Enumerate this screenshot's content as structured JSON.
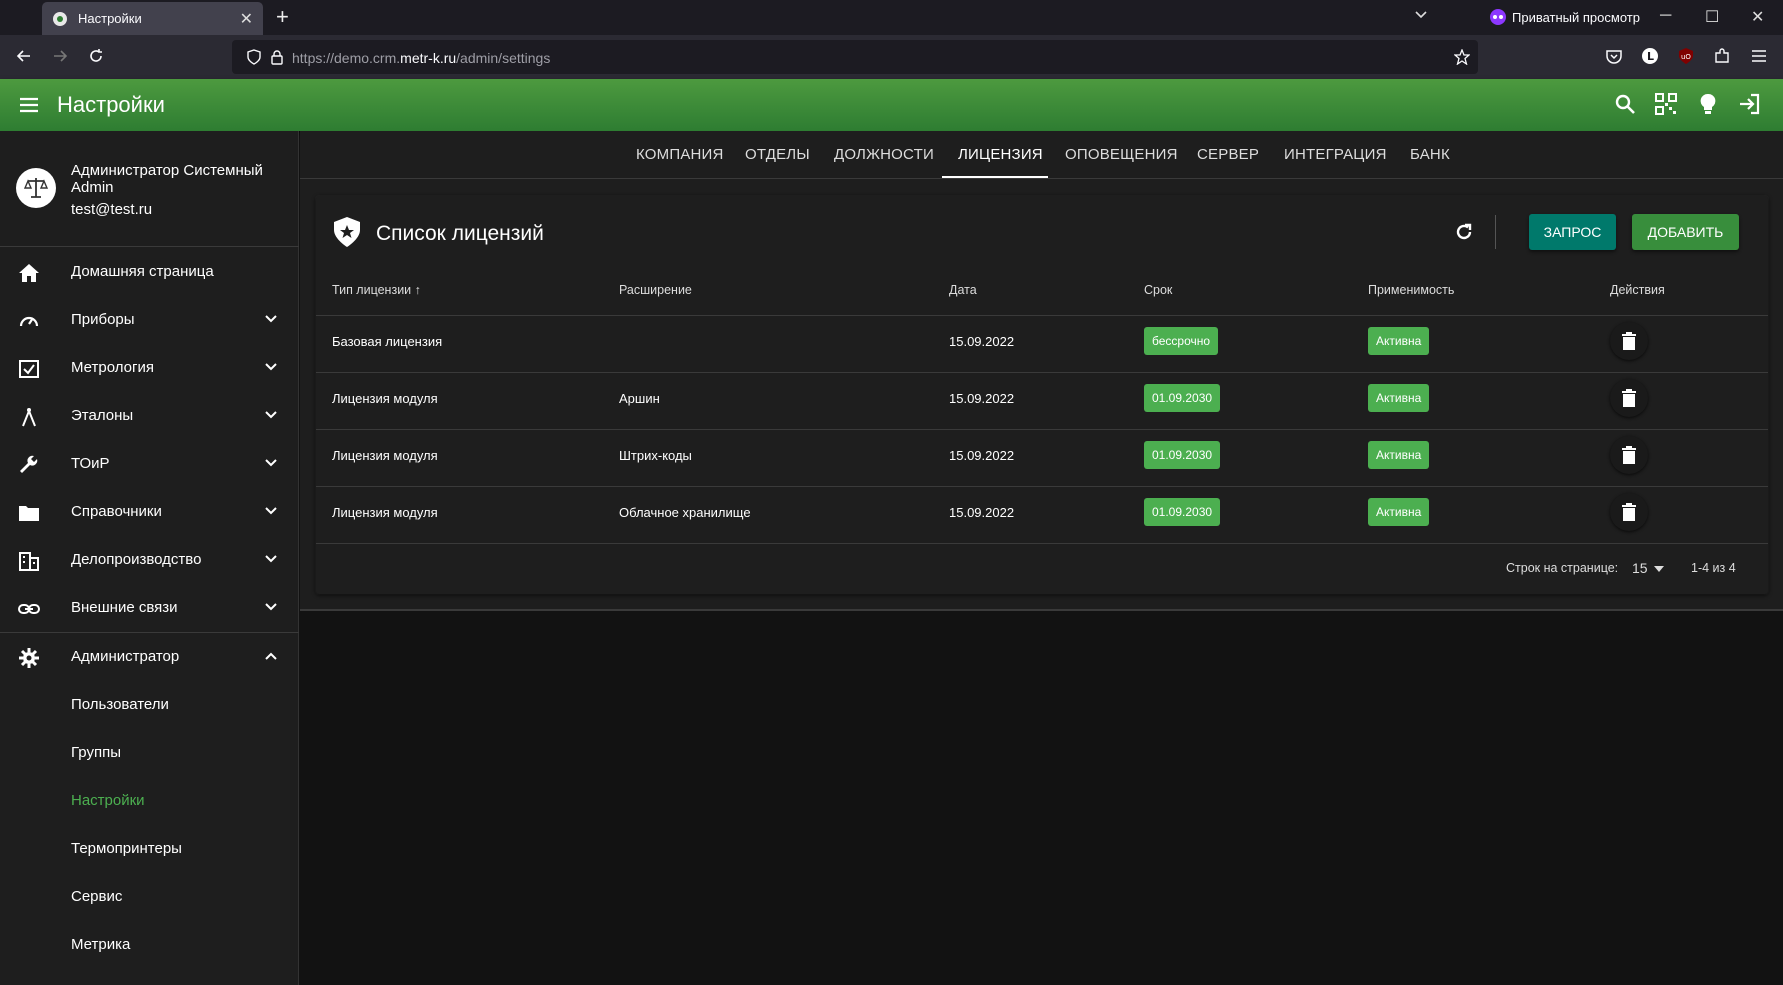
{
  "browser": {
    "tab_title": "Настройки",
    "url_prefix": "https://demo.crm.",
    "url_domain": "metr-k.ru",
    "url_path": "/admin/settings",
    "private_label": "Приватный просмотр"
  },
  "appbar": {
    "title": "Настройки"
  },
  "user": {
    "name": "Администратор Системный Admin",
    "email": "test@test.ru"
  },
  "sidebar": {
    "items": [
      {
        "label": "Домашняя страница",
        "icon": "home-icon"
      },
      {
        "label": "Приборы",
        "icon": "gauge-icon"
      },
      {
        "label": "Метрология",
        "icon": "checkbox-icon"
      },
      {
        "label": "Эталоны",
        "icon": "compass-icon"
      },
      {
        "label": "ТОиР",
        "icon": "wrench-icon"
      },
      {
        "label": "Справочники",
        "icon": "folder-icon"
      },
      {
        "label": "Делопроизводство",
        "icon": "building-icon"
      },
      {
        "label": "Внешние связи",
        "icon": "link-icon"
      },
      {
        "label": "Администратор",
        "icon": "gear-icon"
      }
    ],
    "subitems": [
      {
        "label": "Пользователи"
      },
      {
        "label": "Группы"
      },
      {
        "label": "Настройки"
      },
      {
        "label": "Термопринтеры"
      },
      {
        "label": "Сервис"
      },
      {
        "label": "Метрика"
      }
    ],
    "active_subitem": "Настройки"
  },
  "tabs": [
    "КОМПАНИЯ",
    "ОТДЕЛЫ",
    "ДОЛЖНОСТИ",
    "ЛИЦЕНЗИЯ",
    "ОПОВЕЩЕНИЯ",
    "СЕРВЕР",
    "ИНТЕГРАЦИЯ",
    "БАНК"
  ],
  "active_tab": "ЛИЦЕНЗИЯ",
  "card": {
    "title": "Список лицензий",
    "request_label": "Запрос",
    "add_label": "Добавить"
  },
  "table": {
    "headers": [
      "Тип лицензии",
      "Расширение",
      "Дата",
      "Срок",
      "Применимость",
      "Действия"
    ],
    "rows": [
      {
        "type": "Базовая лицензия",
        "ext": "",
        "date": "15.09.2022",
        "term": "бессрочно",
        "status": "Активна"
      },
      {
        "type": "Лицензия модуля",
        "ext": "Аршин",
        "date": "15.09.2022",
        "term": "01.09.2030",
        "status": "Активна"
      },
      {
        "type": "Лицензия модуля",
        "ext": "Штрих-коды",
        "date": "15.09.2022",
        "term": "01.09.2030",
        "status": "Активна"
      },
      {
        "type": "Лицензия модуля",
        "ext": "Облачное хранилище",
        "date": "15.09.2022",
        "term": "01.09.2030",
        "status": "Активна"
      }
    ]
  },
  "pagination": {
    "rows_per_page_label": "Строк на странице:",
    "rows_per_page": "15",
    "range": "1-4 из 4"
  },
  "colors": {
    "appbar": "#2e7d32",
    "chip": "#4caf50",
    "request_button": "#00796b",
    "add_button": "#388e3c",
    "active_nav": "#4caf50"
  }
}
